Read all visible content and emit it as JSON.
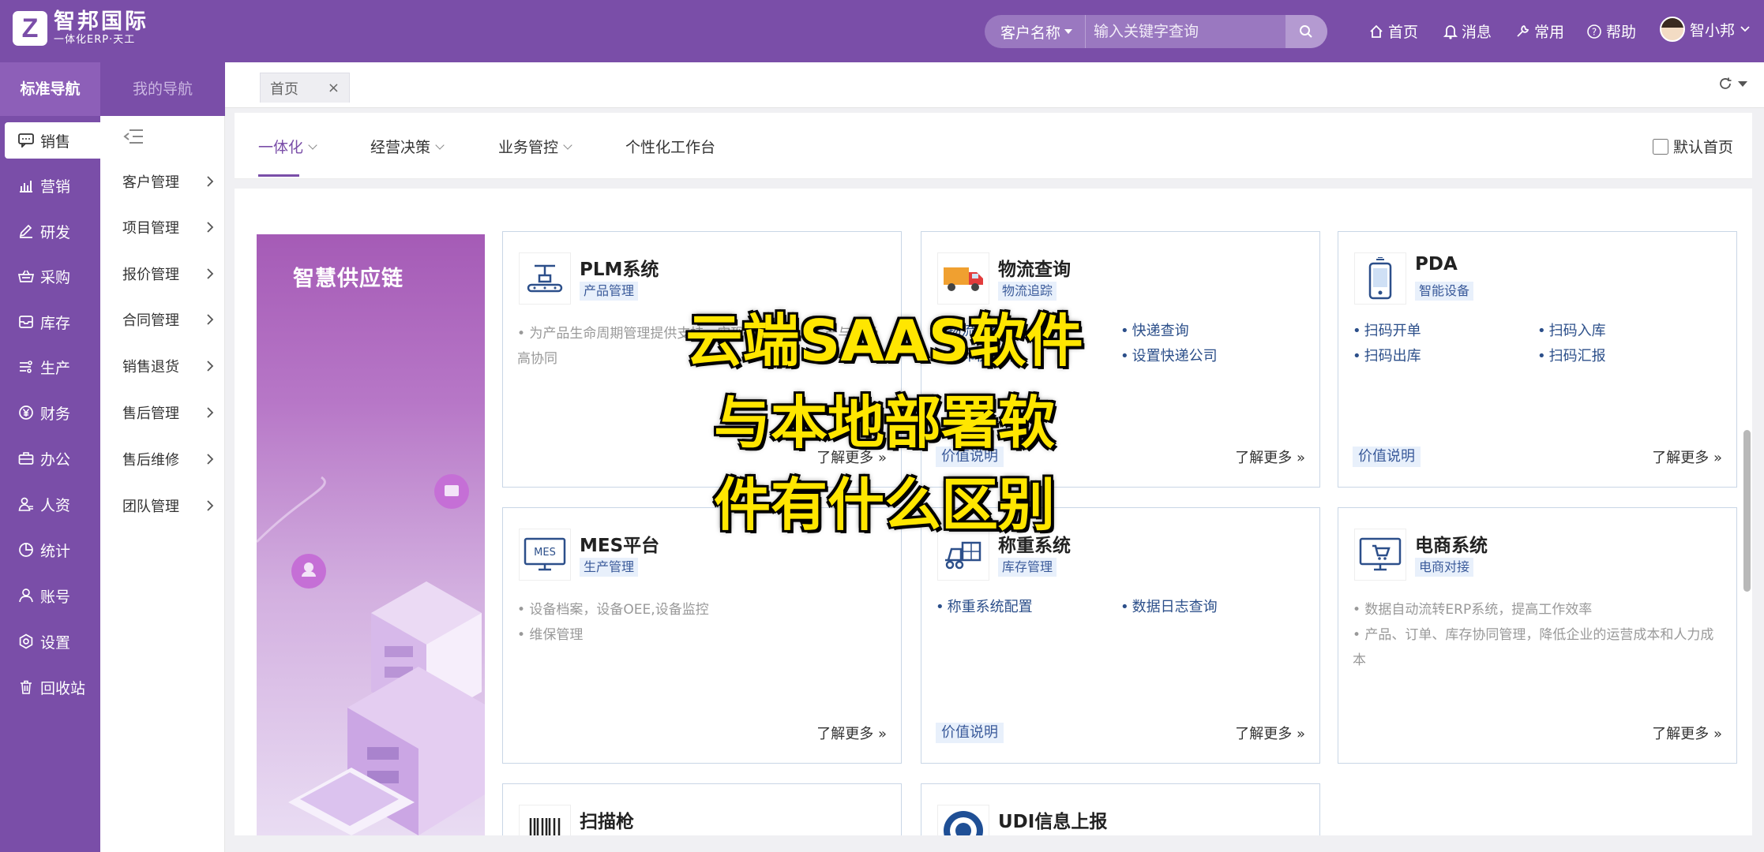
{
  "app": {
    "logo_name": "智邦国际",
    "logo_sub": "一体化ERP·天工",
    "accent": "#7a4ea8"
  },
  "search": {
    "select_label": "客户名称",
    "placeholder": "输入关键字查询"
  },
  "topnav": {
    "home": "首页",
    "messages": "消息",
    "common": "常用",
    "help": "帮助",
    "user": "智小邦"
  },
  "sidebar": {
    "tab_standard": "标准导航",
    "tab_mine": "我的导航",
    "items": [
      {
        "label": "销售",
        "icon": "chat-icon"
      },
      {
        "label": "营销",
        "icon": "chart-icon"
      },
      {
        "label": "研发",
        "icon": "pen-icon"
      },
      {
        "label": "采购",
        "icon": "basket-icon"
      },
      {
        "label": "库存",
        "icon": "inventory-icon"
      },
      {
        "label": "生产",
        "icon": "production-icon"
      },
      {
        "label": "财务",
        "icon": "yen-icon"
      },
      {
        "label": "办公",
        "icon": "briefcase-icon"
      },
      {
        "label": "人资",
        "icon": "person-icon"
      },
      {
        "label": "统计",
        "icon": "pie-icon"
      },
      {
        "label": "账号",
        "icon": "account-icon"
      },
      {
        "label": "设置",
        "icon": "settings-icon"
      },
      {
        "label": "回收站",
        "icon": "trash-icon"
      }
    ],
    "sub_items": [
      "客户管理",
      "项目管理",
      "报价管理",
      "合同管理",
      "销售退货",
      "售后管理",
      "售后维修",
      "团队管理"
    ]
  },
  "tabs": {
    "home_tab": "首页",
    "close": "×"
  },
  "modules": {
    "tabs": [
      "一体化",
      "经营决策",
      "业务管控",
      "个性化工作台"
    ],
    "default_home": "默认首页"
  },
  "banner": {
    "title": "智慧供应链"
  },
  "cards": [
    {
      "title": "PLM系统",
      "badge": "产品管理",
      "desc": "• 为产品生命周期管理提供支持，实现产品研发、生产与市场高协同",
      "learn": "了解更多 »"
    },
    {
      "title": "物流查询",
      "badge": "物流追踪",
      "links": [
        "物流单查询",
        "快递查询",
        "打印快递单",
        "设置快递公司"
      ],
      "value": "价值说明",
      "learn": "了解更多 »"
    },
    {
      "title": "PDA",
      "badge": "智能设备",
      "links": [
        "扫码开单",
        "扫码入库",
        "扫码出库",
        "扫码汇报"
      ],
      "value": "价值说明",
      "learn": "了解更多 »"
    },
    {
      "title": "MES平台",
      "badge": "生产管理",
      "desc_lines": [
        "• 设备档案，设备OEE,设备监控",
        "• 维保管理"
      ],
      "learn": "了解更多 »"
    },
    {
      "title": "称重系统",
      "badge": "库存管理",
      "links": [
        "称重系统配置",
        "数据日志查询"
      ],
      "value": "价值说明",
      "learn": "了解更多 »"
    },
    {
      "title": "电商系统",
      "badge": "电商对接",
      "desc_lines": [
        "• 数据自动流转ERP系统，提高工作效率",
        "• 产品、订单、库存协同管理，降低企业的运营成本和人力成本"
      ],
      "learn": "了解更多 »"
    },
    {
      "title": "扫描枪"
    },
    {
      "title": "UDI信息上报"
    }
  ],
  "caption": {
    "line1": "云端SAAS软件",
    "line2": "与本地部署软",
    "line3": "件有什么区别"
  }
}
